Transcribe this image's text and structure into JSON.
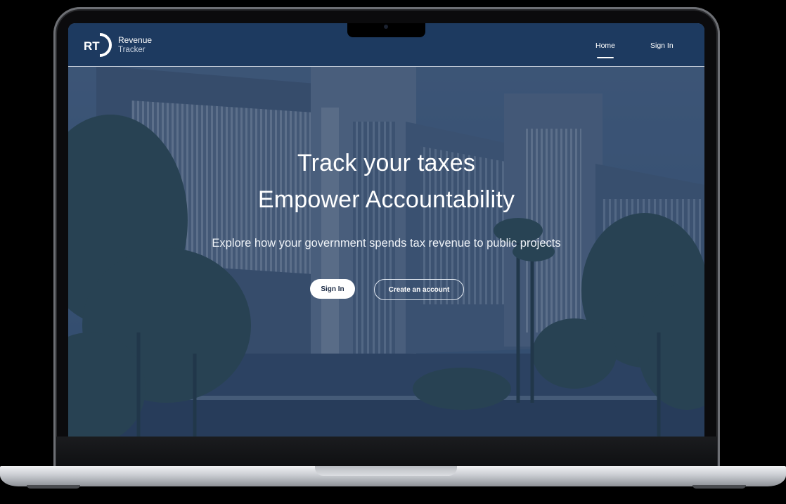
{
  "brand": {
    "logo_mark": "RT",
    "name_line1": "Revenue",
    "name_line2": "Tracker"
  },
  "nav": {
    "items": [
      {
        "label": "Home",
        "active": true
      },
      {
        "label": "Sign In",
        "active": false
      }
    ]
  },
  "hero": {
    "title_line1": "Track your taxes",
    "title_line2": "Empower Accountability",
    "subtitle": "Explore how your government spends tax revenue to public projects",
    "primary_button": "Sign In",
    "secondary_button": "Create an account",
    "background_image": "government-building-photo"
  },
  "colors": {
    "navbar": "#1d3a60",
    "overlay": "#1a3256",
    "accent": "#ffffff"
  }
}
